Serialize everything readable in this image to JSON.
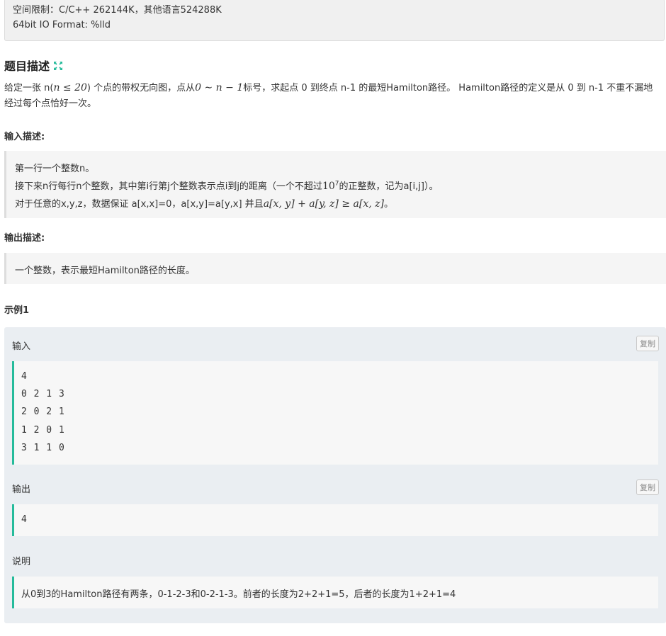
{
  "info": {
    "memory_limit": "空间限制：C/C++ 262144K，其他语言524288K",
    "io_format": "64bit IO Format: %lld"
  },
  "description": {
    "title": "题目描述",
    "title_icon": "expand-icon",
    "accent_color": "#25bb9b",
    "text_1": "给定一张 n(",
    "math_n_le_20": "n ≤ 20",
    "text_2": ") 个点的带权无向图，点从",
    "math_range": "0 ∼ n − 1",
    "text_3": "标号，求起点 0 到终点 n-1 的最短Hamilton路径。 Hamilton路径的定义是从 0 到 n-1 不重不漏地经过每个点恰好一次。"
  },
  "input_desc": {
    "title": "输入描述:",
    "line1": "第一行一个整数n。",
    "line2_a": "接下来n行每行n个整数，其中第i行第j个整数表示点i到j的距离（一个不超过",
    "line2_math": "10",
    "line2_exp": "7",
    "line2_b": "的正整数，记为a[i,j]）。",
    "line3_a": "对于任意的x,y,z，数据保证 a[x,x]=0，a[x,y]=a[y,x] 并且",
    "line3_math": "a[x, y] + a[y, z] ≥ a[x, z]",
    "line3_b": "。"
  },
  "output_desc": {
    "title": "输出描述:",
    "line1": "一个整数，表示最短Hamilton路径的长度。"
  },
  "example": {
    "title": "示例1",
    "input_label": "输入",
    "copy_label": "复制",
    "input_lines": [
      "4",
      "0 2 1 3",
      "2 0 2 1",
      "1 2 0 1",
      "3 1 1 0"
    ],
    "output_label": "输出",
    "output_lines": [
      "4"
    ],
    "explain_label": "说明",
    "explain_text": "从0到3的Hamilton路径有两条，0-1-2-3和0-2-1-3。前者的长度为2+2+1=5，后者的长度为1+2+1=4"
  }
}
